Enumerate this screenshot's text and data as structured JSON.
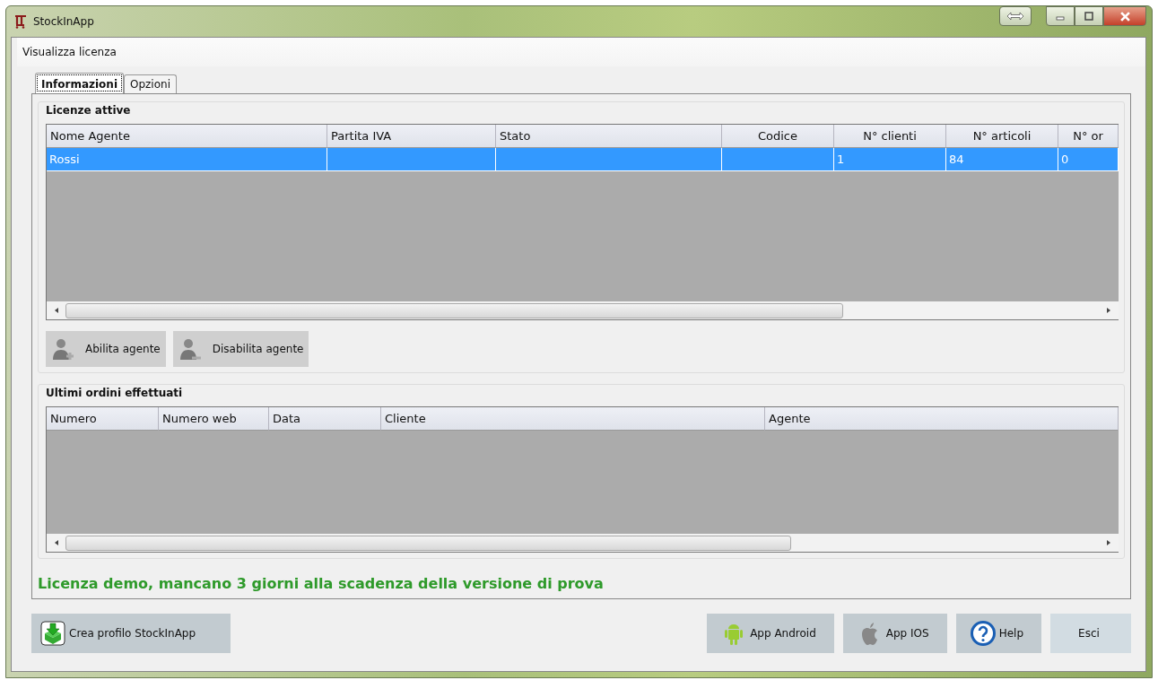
{
  "window": {
    "title": "StockInApp"
  },
  "menu": {
    "label": "Visualizza licenza"
  },
  "tabs": [
    {
      "label": "Informazioni",
      "selected": true
    },
    {
      "label": "Opzioni",
      "selected": false
    }
  ],
  "licenses": {
    "title": "Licenze attive",
    "columns": [
      "Nome Agente",
      "Partita IVA",
      "Stato",
      "Codice",
      "N° clienti",
      "N° articoli",
      "N° or"
    ],
    "rows": [
      {
        "selected": true,
        "cells": [
          "Rossi",
          "",
          "",
          "",
          "1",
          "84",
          "0"
        ]
      }
    ],
    "buttons": [
      "Abilita agente",
      "Disabilita agente"
    ]
  },
  "orders": {
    "title": "Ultimi ordini effettuati",
    "columns": [
      "Numero",
      "Numero web",
      "Data",
      "Cliente",
      "Agente"
    ]
  },
  "notice": "Licenza demo, mancano 3 giorni alla scadenza della versione di prova",
  "footer_buttons": [
    "Crea profilo StockInApp",
    "App Android",
    "App IOS",
    "Help",
    "Esci"
  ]
}
